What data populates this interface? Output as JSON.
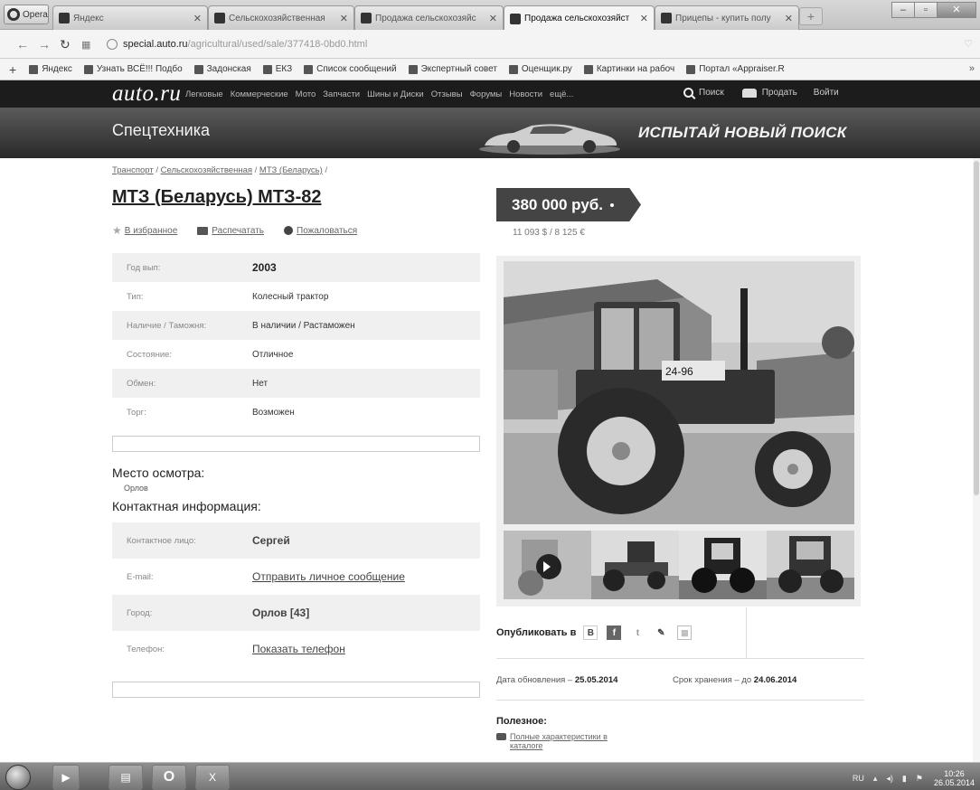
{
  "browser": {
    "menu_label": "Opera",
    "tabs": [
      {
        "label": "Яндекс"
      },
      {
        "label": "Сельскохозяйственная"
      },
      {
        "label": "Продажа сельскохозяйс"
      },
      {
        "label": "Продажа сельскохозяйст"
      },
      {
        "label": "Прицепы - купить полу"
      }
    ],
    "new_tab": "+",
    "url_host": "special.auto.ru",
    "url_path": "/agricultural/used/sale/377418-0bd0.html",
    "bookmarks": [
      "Яндекс",
      "Узнать ВСЁ!!! Подбо",
      "Задонская",
      "ЕКЗ",
      "Список сообщений",
      "Экспертный совет",
      "Оценщик.ру",
      "Картинки на рабоч",
      "Портал «Appraiser.R"
    ],
    "bookmarks_more": "»"
  },
  "site": {
    "logo": "auto.ru",
    "nav": [
      "Легковые",
      "Коммерческие",
      "Мото",
      "Запчасти",
      "Шины и Диски",
      "Отзывы",
      "Форумы",
      "Новости",
      "ещё..."
    ],
    "search": "Поиск",
    "sell": "Продать",
    "login": "Войти",
    "section_title": "Спецтехника",
    "banner_slogan": "ИСПЫТАЙ НОВЫЙ ПОИСК"
  },
  "listing": {
    "breadcrumb": [
      "Транспорт",
      "Сельскохозяйственная",
      "МТЗ (Беларусь)"
    ],
    "breadcrumb_sep": "/",
    "title": "МТЗ (Беларусь) МТЗ-82",
    "actions": {
      "favorite": "В избранное",
      "print": "Распечатать",
      "complain": "Пожаловаться"
    },
    "specs": [
      {
        "key": "Год вып:",
        "value": "2003"
      },
      {
        "key": "Тип:",
        "value": "Колесный трактор"
      },
      {
        "key": "Наличие / Таможня:",
        "value": "В наличии / Растаможен"
      },
      {
        "key": "Состояние:",
        "value": "Отличное"
      },
      {
        "key": "Обмен:",
        "value": "Нет"
      },
      {
        "key": "Торг:",
        "value": "Возможен"
      }
    ],
    "place_heading": "Место осмотра:",
    "place_value": "Орлов",
    "contact_heading": "Контактная информация:",
    "contacts": [
      {
        "key": "Контактное лицо:",
        "value": "Сергей"
      },
      {
        "key": "E-mail:",
        "value": "Отправить личное сообщение"
      },
      {
        "key": "Город:",
        "value": "Орлов [43]"
      },
      {
        "key": "Телефон:",
        "value": "Показать телефон"
      }
    ],
    "price": "380 000 руб.",
    "price_alt": "11 093 $ / 8 125 €",
    "plate_text": "24-96",
    "share_label": "Опубликовать в",
    "share_b": "B",
    "share_f": "f",
    "share_t": "t",
    "updated_label": "Дата обновления – ",
    "updated_value": "25.05.2014",
    "keep_label": "Срок хранения – до ",
    "keep_value": "24.06.2014",
    "useful_heading": "Полезное:",
    "useful_link": "Полные характеристики в каталоге"
  },
  "taskbar": {
    "lang": "RU",
    "time": "10:26",
    "date": "26.05.2014"
  }
}
